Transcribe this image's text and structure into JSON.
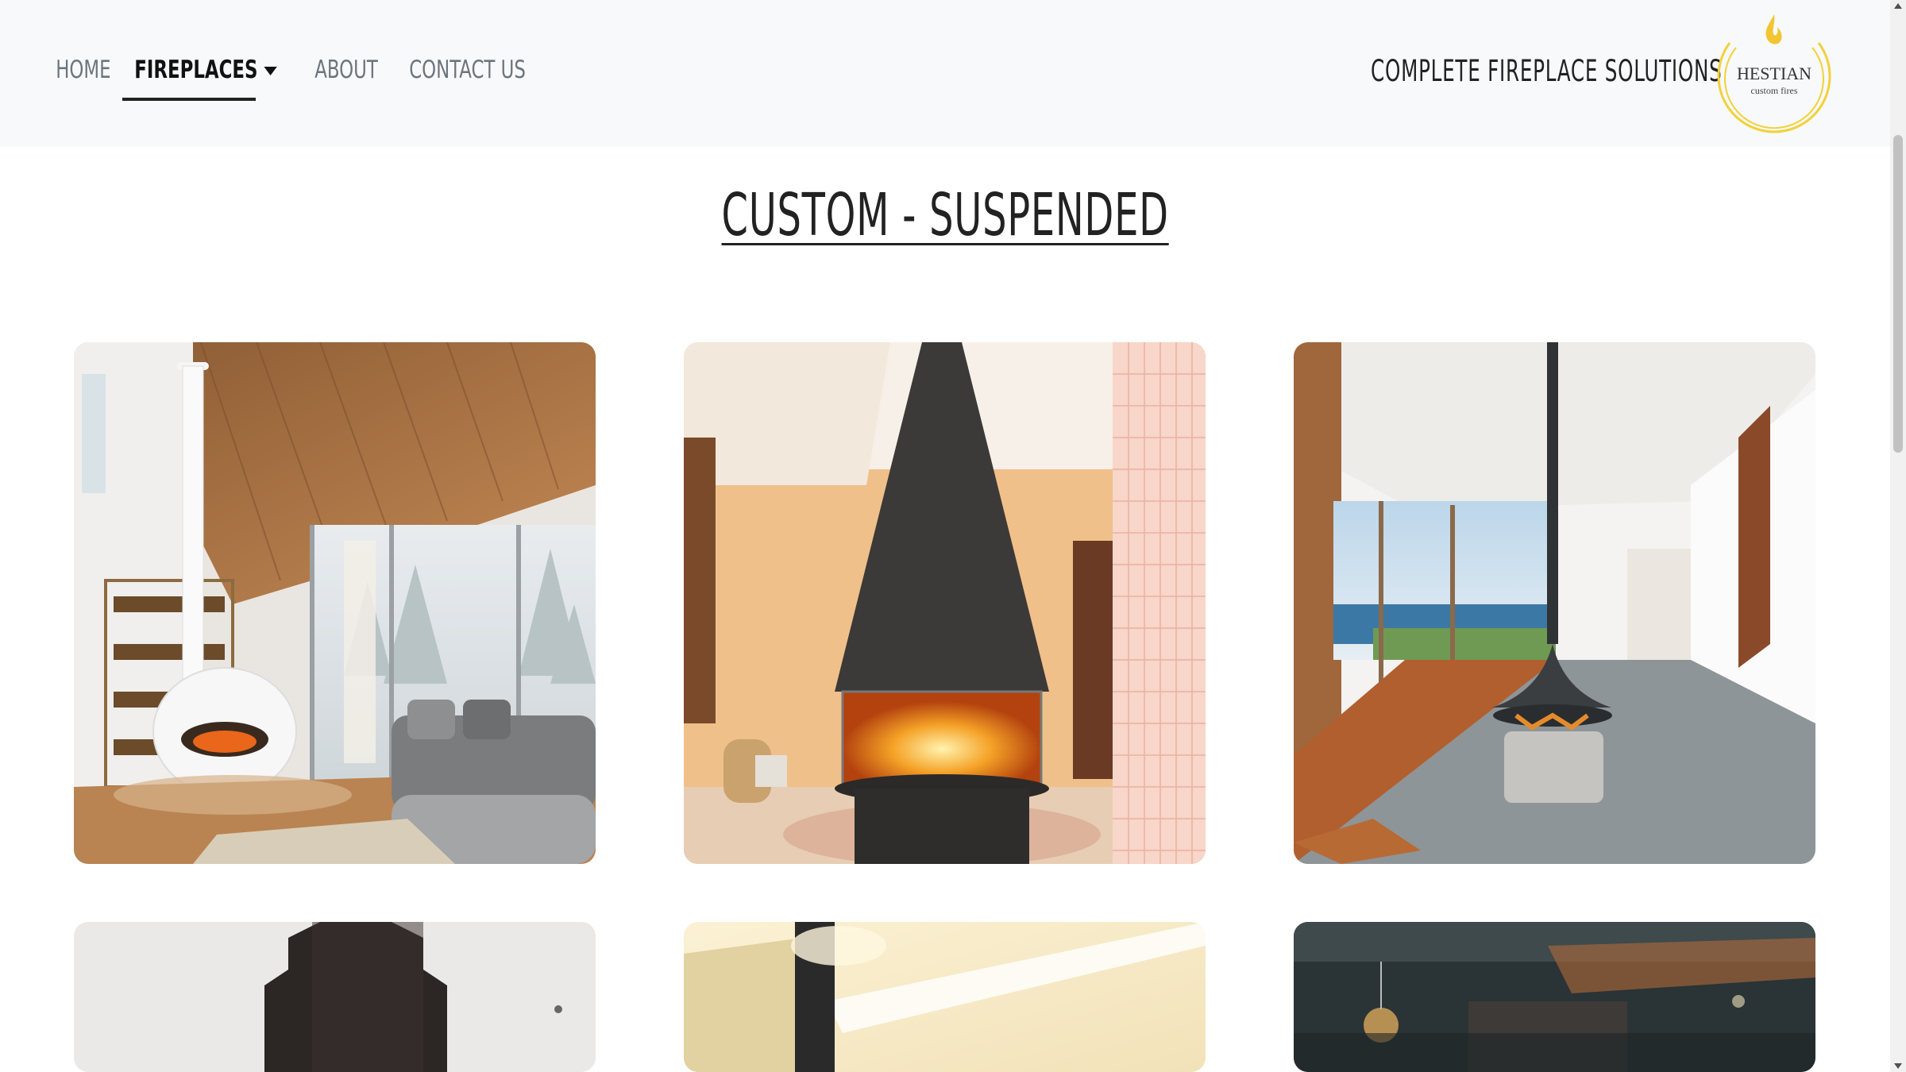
{
  "nav": {
    "items": [
      {
        "label": "HOME",
        "active": false
      },
      {
        "label": "FIREPLACES",
        "active": true,
        "has_dropdown": true
      },
      {
        "label": "ABOUT",
        "active": false
      },
      {
        "label": "CONTACT US",
        "active": false
      }
    ]
  },
  "brand": {
    "tagline": "COMPLETE  FIREPLACE  SOLUTIONS",
    "logo_name": "HESTIAN",
    "logo_sub": "custom fires",
    "logo_color": "#f2d13a"
  },
  "page": {
    "title": "CUSTOM - SUSPENDED"
  },
  "gallery": {
    "images": [
      {
        "name": "white-suspended-fireplace-living-room"
      },
      {
        "name": "black-cone-fireplace-orange-room"
      },
      {
        "name": "black-suspended-fireplace-terrace"
      },
      {
        "name": "dark-box-chimney-fireplace"
      },
      {
        "name": "black-flue-cream-room-fireplace"
      },
      {
        "name": "dark-interior-fireplace"
      }
    ]
  }
}
